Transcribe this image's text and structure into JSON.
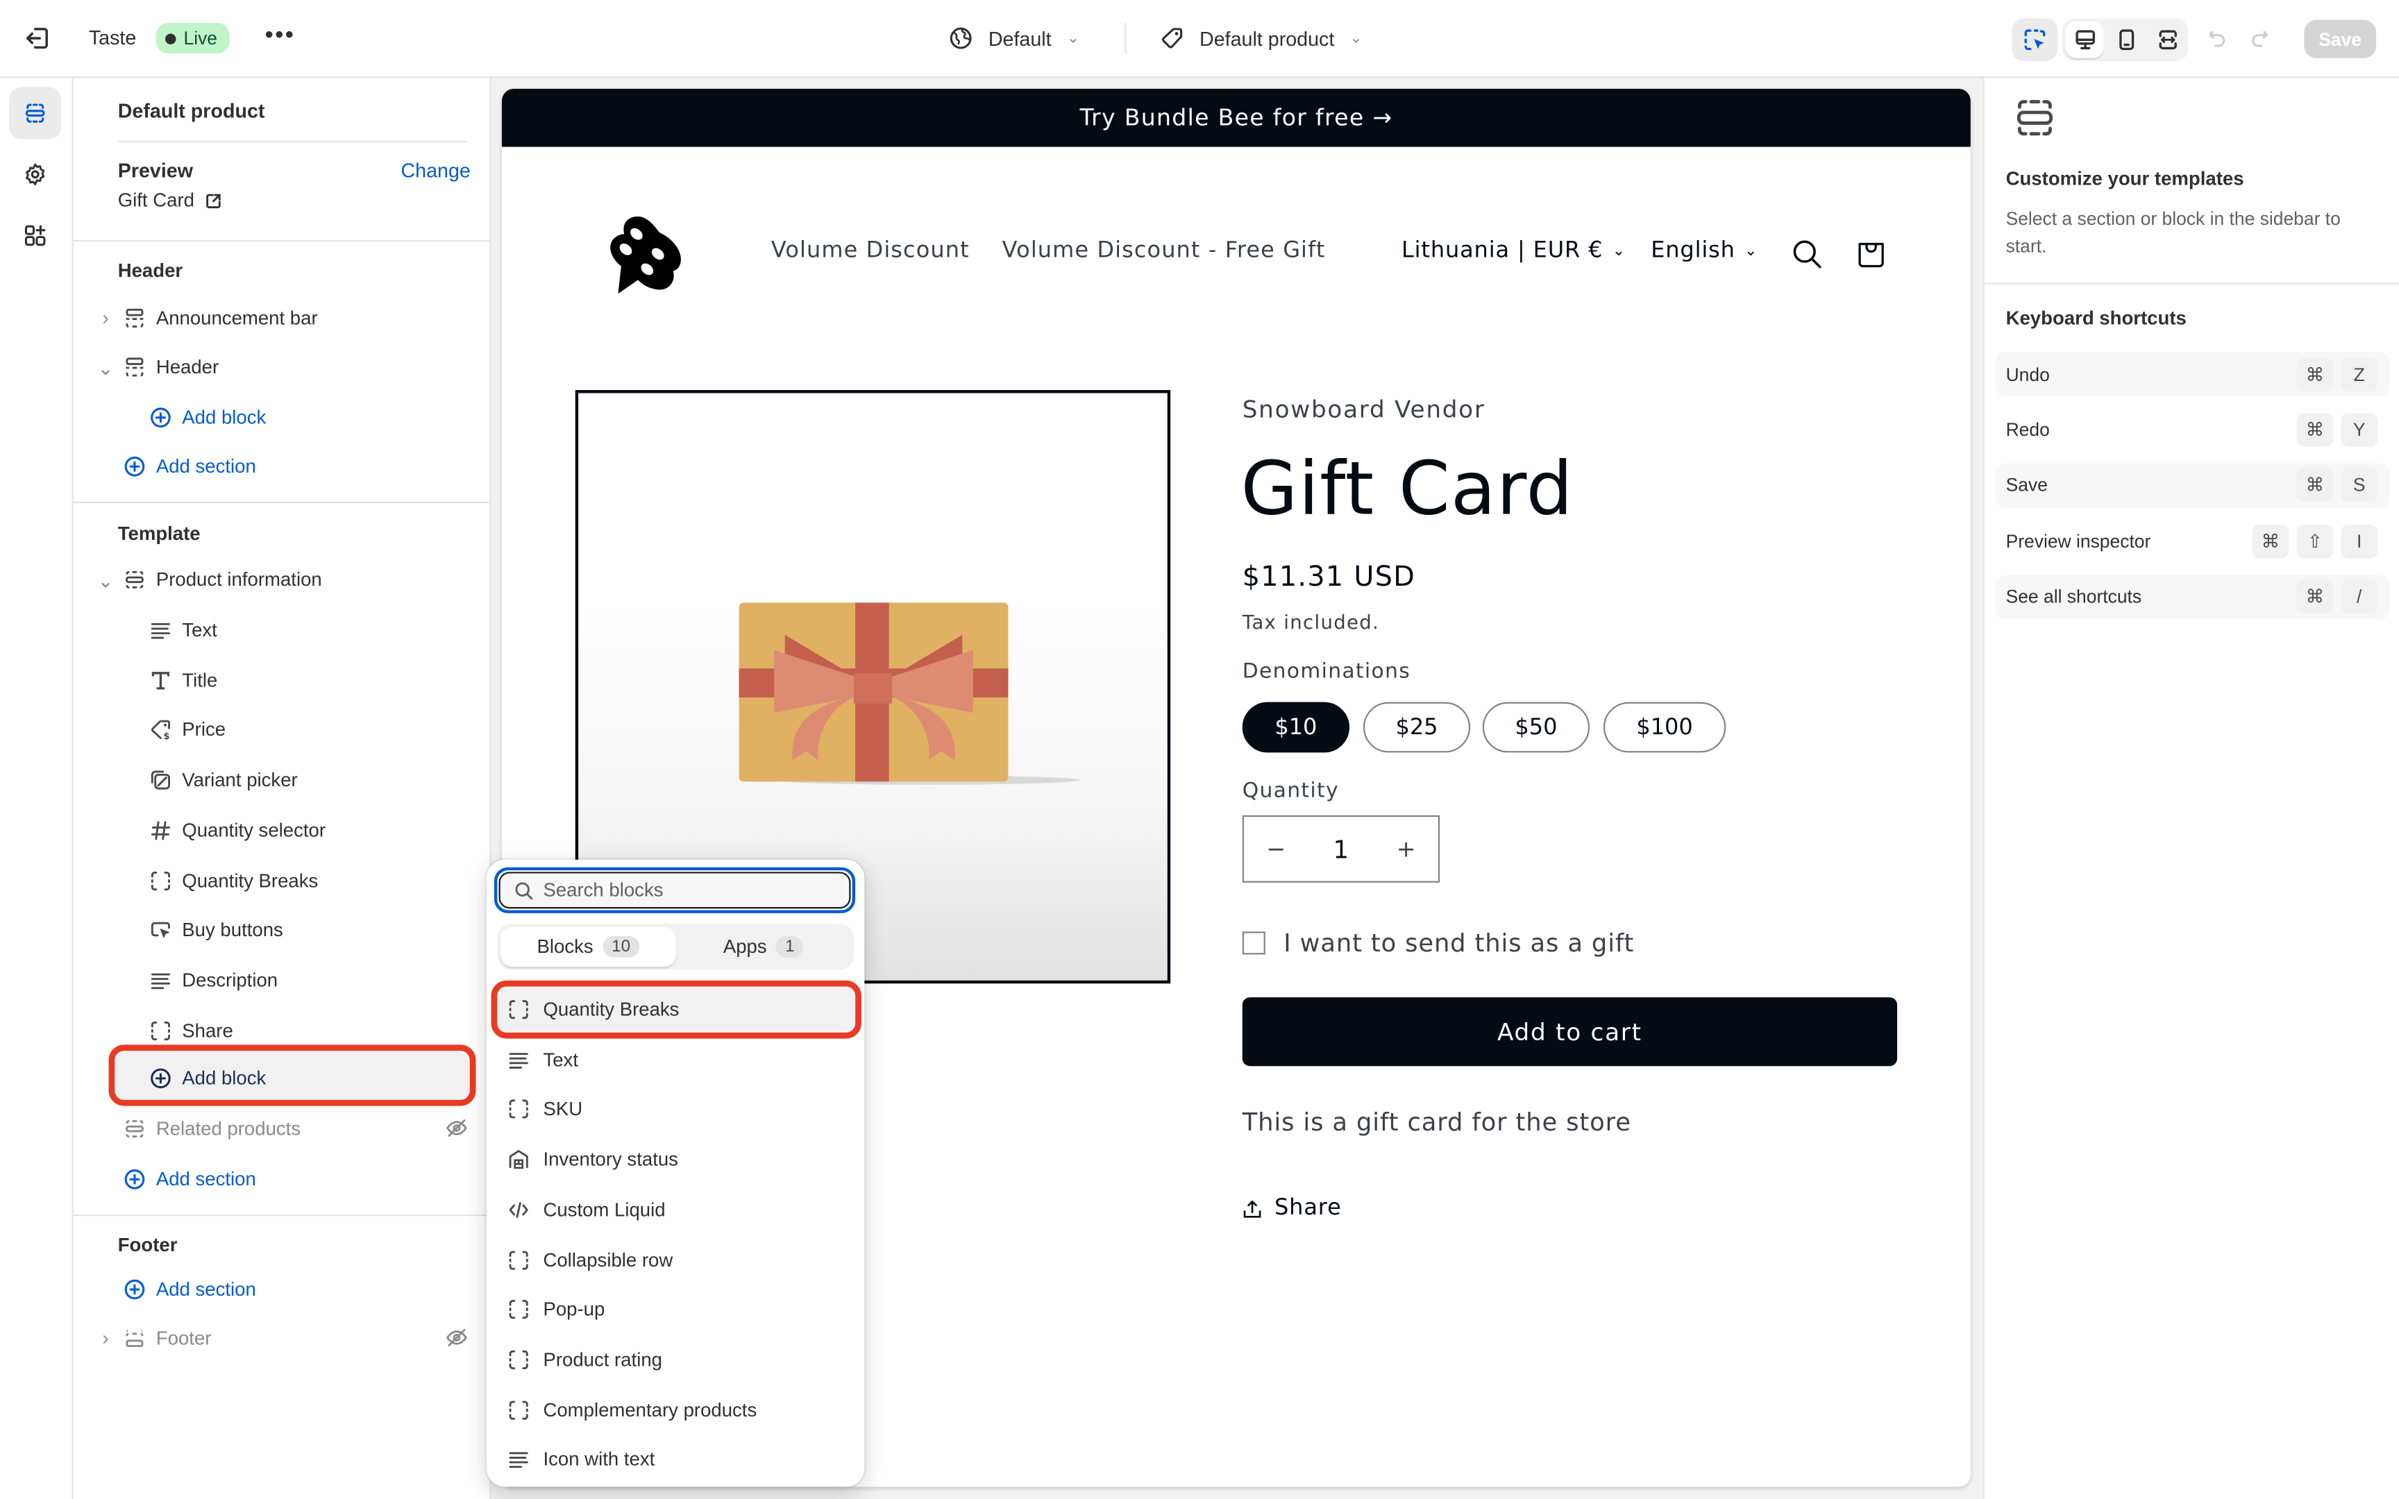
{
  "topbar": {
    "store_name": "Taste",
    "status_badge": "Live",
    "more_label": "•••",
    "theme_selector": "Default",
    "template_selector": "Default product",
    "save_label": "Save"
  },
  "sidebar": {
    "title": "Default product",
    "preview_label": "Preview",
    "change_label": "Change",
    "preview_value": "Gift Card",
    "groups": {
      "header": {
        "label": "Header",
        "items": [
          {
            "label": "Announcement bar",
            "icon": "section-icon",
            "toggle": "chevron-right"
          },
          {
            "label": "Header",
            "icon": "section-icon",
            "toggle": "chevron-down"
          }
        ],
        "add_block": "Add block",
        "add_section": "Add section"
      },
      "template": {
        "label": "Template",
        "section": {
          "label": "Product information",
          "icon": "section-icon",
          "toggle": "chevron-down"
        },
        "blocks": [
          {
            "label": "Text",
            "icon": "text-lines-icon"
          },
          {
            "label": "Title",
            "icon": "title-t-icon"
          },
          {
            "label": "Price",
            "icon": "price-tag-icon"
          },
          {
            "label": "Variant picker",
            "icon": "variant-icon"
          },
          {
            "label": "Quantity selector",
            "icon": "hash-icon"
          },
          {
            "label": "Quantity Breaks",
            "icon": "dashed-square-icon"
          },
          {
            "label": "Buy buttons",
            "icon": "cursor-button-icon"
          },
          {
            "label": "Description",
            "icon": "text-lines-icon"
          },
          {
            "label": "Share",
            "icon": "dashed-square-icon"
          }
        ],
        "add_block": "Add block",
        "related": {
          "label": "Related products",
          "hidden": true
        },
        "add_section": "Add section"
      },
      "footer": {
        "label": "Footer",
        "add_section": "Add section",
        "footer_item": {
          "label": "Footer",
          "hidden": true
        }
      }
    }
  },
  "popover": {
    "search_placeholder": "Search blocks",
    "search_value": "",
    "tabs": [
      {
        "label": "Blocks",
        "count": "10",
        "active": true
      },
      {
        "label": "Apps",
        "count": "1",
        "active": false
      }
    ],
    "items": [
      {
        "label": "Quantity Breaks",
        "icon": "dashed-square-icon",
        "highlighted": true
      },
      {
        "label": "Text",
        "icon": "text-lines-icon"
      },
      {
        "label": "SKU",
        "icon": "dashed-square-icon"
      },
      {
        "label": "Inventory status",
        "icon": "warehouse-icon"
      },
      {
        "label": "Custom Liquid",
        "icon": "code-icon"
      },
      {
        "label": "Collapsible row",
        "icon": "dashed-square-icon"
      },
      {
        "label": "Pop-up",
        "icon": "dashed-square-icon"
      },
      {
        "label": "Product rating",
        "icon": "dashed-square-icon"
      },
      {
        "label": "Complementary products",
        "icon": "dashed-square-icon"
      },
      {
        "label": "Icon with text",
        "icon": "text-lines-icon"
      }
    ]
  },
  "preview": {
    "announcement": "Try Bundle Bee for free →",
    "nav": [
      "Volume Discount",
      "Volume Discount - Free Gift"
    ],
    "country": "Lithuania | EUR €",
    "language": "English",
    "product": {
      "vendor": "Snowboard Vendor",
      "title": "Gift Card",
      "price": "$11.31 USD",
      "tax_note": "Tax included.",
      "denominations_label": "Denominations",
      "denominations": [
        "$10",
        "$25",
        "$50",
        "$100"
      ],
      "selected_denomination": "$10",
      "quantity_label": "Quantity",
      "quantity": "1",
      "minus": "−",
      "plus": "+",
      "gift_checkbox_label": "I want to send this as a gift",
      "gift_checked": false,
      "add_to_cart": "Add to cart",
      "description": "This is a gift card for the store",
      "share_label": "Share"
    }
  },
  "right_panel": {
    "title": "Customize your templates",
    "description": "Select a section or block in the sidebar to start.",
    "shortcuts_title": "Keyboard shortcuts",
    "shortcuts": [
      {
        "label": "Undo",
        "keys": [
          "⌘",
          "Z"
        ]
      },
      {
        "label": "Redo",
        "keys": [
          "⌘",
          "Y"
        ]
      },
      {
        "label": "Save",
        "keys": [
          "⌘",
          "S"
        ]
      },
      {
        "label": "Preview inspector",
        "keys": [
          "⌘",
          "⇧",
          "I"
        ]
      },
      {
        "label": "See all shortcuts",
        "keys": [
          "⌘",
          "/"
        ]
      }
    ]
  },
  "colors": {
    "accent_blue": "#005bd3",
    "highlight_red": "#e83b25",
    "live_badge_bg": "#c1f5c9",
    "store_dark": "#050b13",
    "gift_card_gold": "#e0b163",
    "ribbon_red": "#c45f4e",
    "bow_salmon": "#de8b74"
  }
}
